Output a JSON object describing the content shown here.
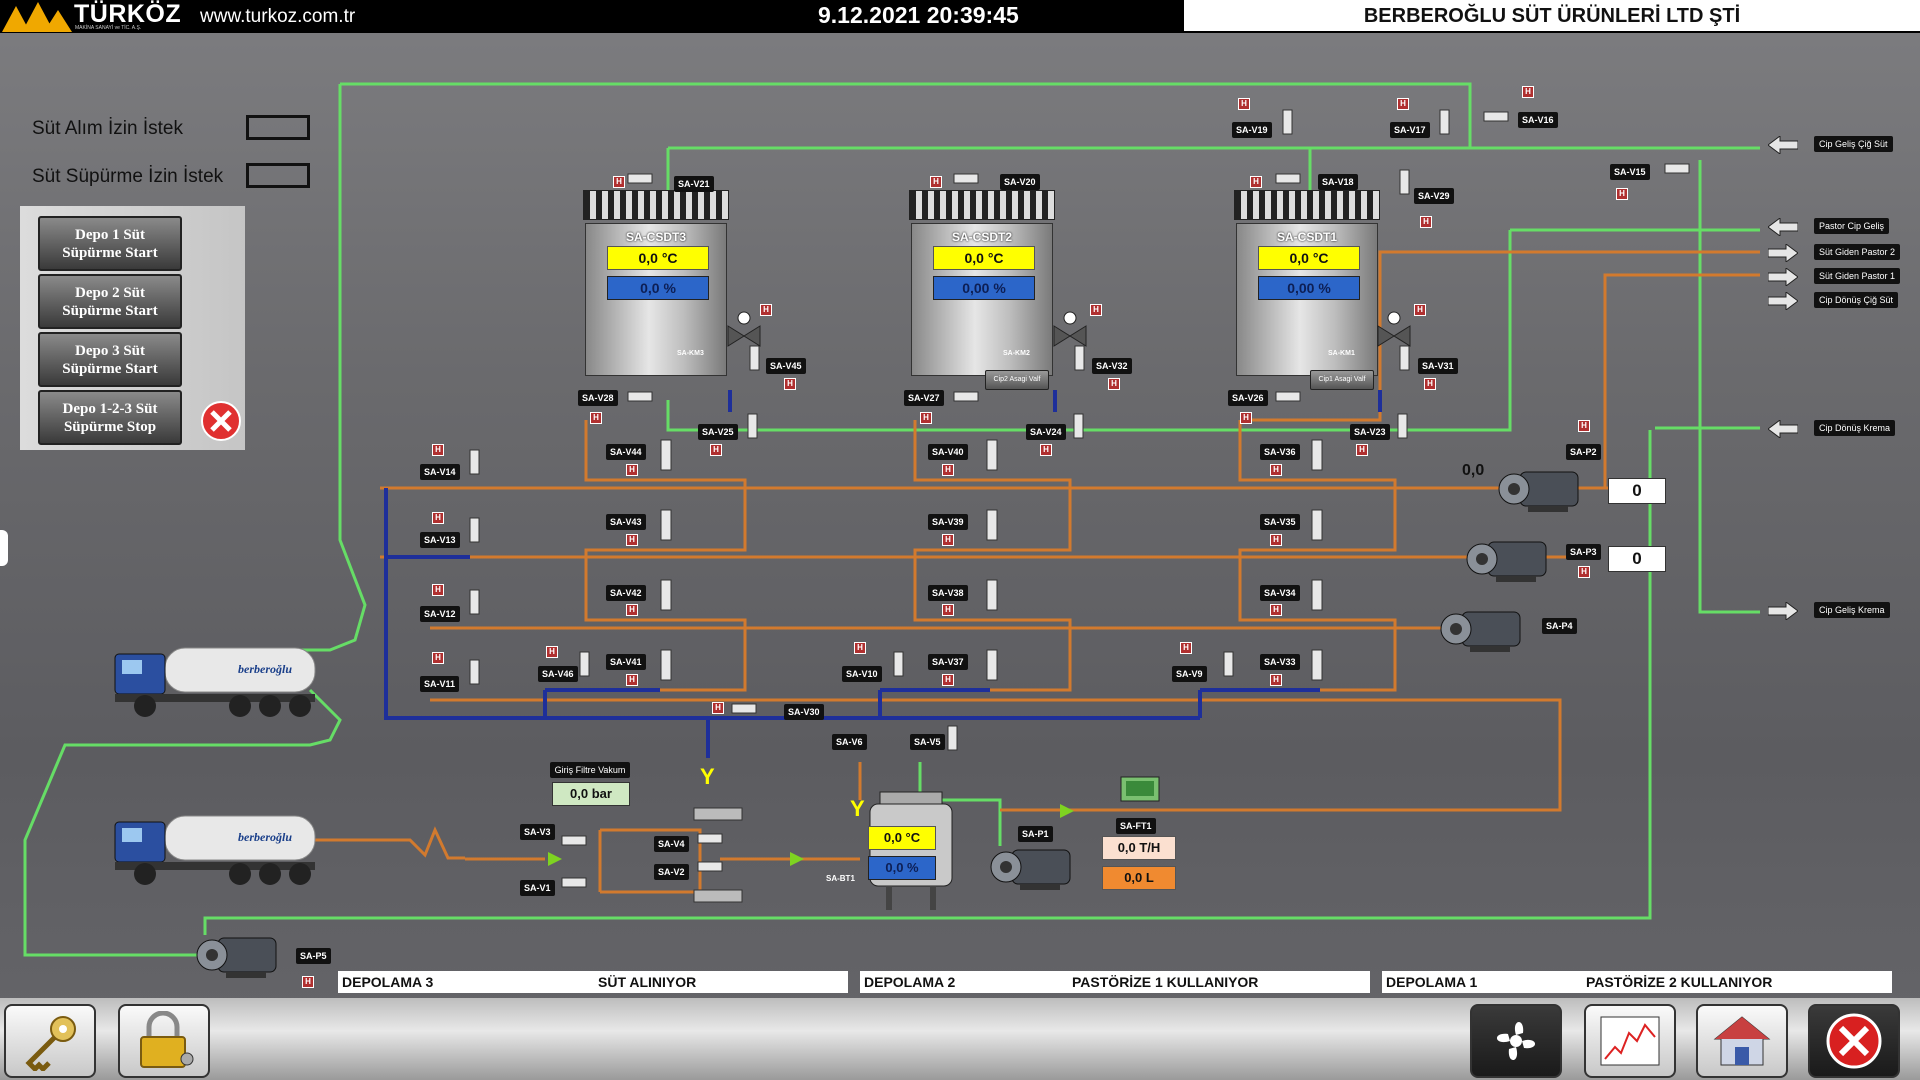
{
  "header": {
    "brand": "TÜRKÖZ",
    "brand_sub": "MAKİNA SANAYİ ve TİC. A.Ş.",
    "website": "www.turkoz.com.tr",
    "datetime": "9.12.2021 20:39:45",
    "company": "BERBEROĞLU SÜT ÜRÜNLERİ LTD ŞTİ"
  },
  "requests": {
    "milk_intake": "Süt Alım İzin İstek",
    "milk_sweep": "Süt Süpürme İzin İstek"
  },
  "sweep_buttons": [
    {
      "label": "Depo 1 Süt\nSüpürme  Start"
    },
    {
      "label": "Depo 2 Süt\nSüpürme  Start"
    },
    {
      "label": "Depo 3 Süt\nSüpürme  Start"
    },
    {
      "label": "Depo 1-2-3 Süt\nSüpürme  Stop"
    }
  ],
  "tanks": [
    {
      "name": "SA-CSDT3",
      "temp": "0,0 °C",
      "level": "0,0 %",
      "km": "SA-KM3",
      "cip": ""
    },
    {
      "name": "SA-CSDT2",
      "temp": "0,0 °C",
      "level": "0,00 %",
      "km": "SA-KM2",
      "cip": "Cip2 Asagi Valf"
    },
    {
      "name": "SA-CSDT1",
      "temp": "0,0 °C",
      "level": "0,00 %",
      "km": "SA-KM1",
      "cip": "Cip1 Asagi Valf"
    }
  ],
  "right_lines": [
    "Cip Geliş Çiğ Süt",
    "Pastor Cip Geliş",
    "Süt Giden Pastor 2",
    "Süt Giden Pastor 1",
    "Cip Dönüş Çiğ Süt",
    "Cip Dönüş Krema",
    "Cip Geliş Krema"
  ],
  "valves": {
    "top": [
      "SA-V21",
      "SA-V20",
      "SA-V18",
      "SA-V19",
      "SA-V17",
      "SA-V16",
      "SA-V29",
      "SA-V15"
    ],
    "tank_bottom": [
      "SA-V28",
      "SA-V27",
      "SA-V26",
      "SA-V45",
      "SA-V32",
      "SA-V31",
      "SA-V25",
      "SA-V24",
      "SA-V23"
    ],
    "matrix": [
      "SA-V44",
      "SA-V43",
      "SA-V42",
      "SA-V41",
      "SA-V40",
      "SA-V39",
      "SA-V38",
      "SA-V37",
      "SA-V36",
      "SA-V35",
      "SA-V34",
      "SA-V33"
    ],
    "left": [
      "SA-V14",
      "SA-V13",
      "SA-V12",
      "SA-V11",
      "SA-V46",
      "SA-V10",
      "SA-V9",
      "SA-V30",
      "SA-V6",
      "SA-V5"
    ],
    "intake": [
      "SA-V3",
      "SA-V1",
      "SA-V4",
      "SA-V2"
    ]
  },
  "pumps": {
    "p2": {
      "tag": "SA-P2",
      "speed": "0,0",
      "value": "0"
    },
    "p3": {
      "tag": "SA-P3",
      "value": "0"
    },
    "p4": {
      "tag": "SA-P4"
    },
    "p1": {
      "tag": "SA-P1"
    },
    "p5": {
      "tag": "SA-P5"
    }
  },
  "intake": {
    "filter_label": "Giriş Filtre Vakum",
    "filter_value": "0,0  bar",
    "bt1_tag": "SA-BT1",
    "bt1_temp": "0,0 °C",
    "bt1_level": "0,0 %",
    "ft1_tag": "SA-FT1",
    "flow_rate": "0,0 T/H",
    "flow_total": "0,0 L"
  },
  "status_bar": [
    {
      "name": "DEPOLAMA 3",
      "state": "SÜT ALINIYOR"
    },
    {
      "name": "DEPOLAMA 2",
      "state": "PASTÖRİZE 1 KULLANIYOR"
    },
    {
      "name": "DEPOLAMA 1",
      "state": "PASTÖRİZE 2 KULLANIYOR"
    }
  ],
  "truck_brand": "berberoğlu",
  "colors": {
    "green_pipe": "#66dd66",
    "orange_pipe": "#d27a2e",
    "blue_pipe": "#1e2f9a",
    "yellow": "#ffff00"
  }
}
